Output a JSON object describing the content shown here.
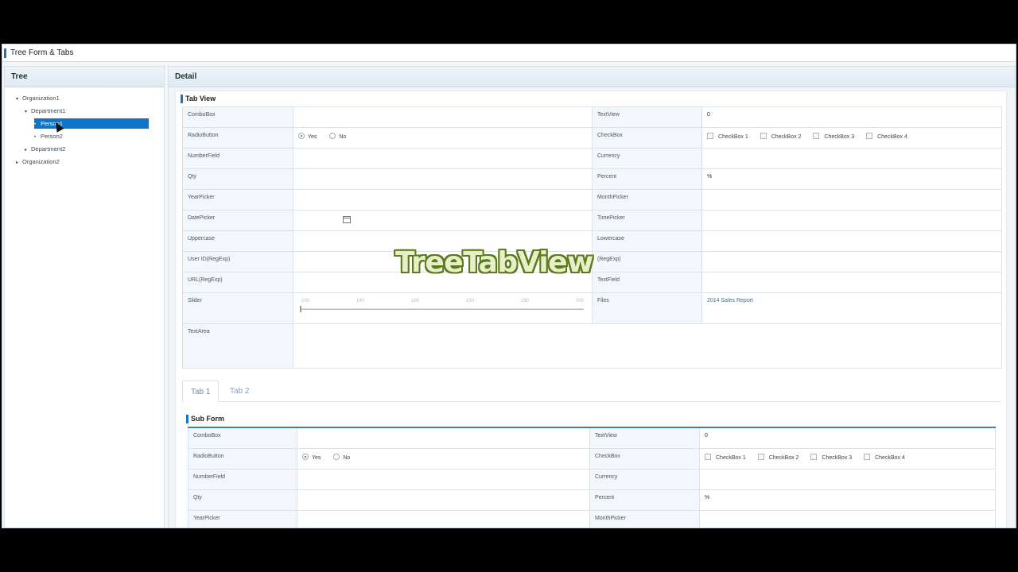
{
  "app": {
    "title": "Tree Form & Tabs"
  },
  "tree": {
    "title": "Tree",
    "nodes": [
      {
        "label": "Organization1",
        "toggle": "▾"
      },
      {
        "label": "Department1",
        "toggle": "▾"
      },
      {
        "label": "Person1",
        "toggle": "•"
      },
      {
        "label": "Person2",
        "toggle": "•"
      },
      {
        "label": "Department2",
        "toggle": "▸"
      },
      {
        "label": "Organization2",
        "toggle": "▸"
      }
    ]
  },
  "detail": {
    "title": "Detail",
    "tab_view_title": "Tab View",
    "fields": {
      "combobox": "ComboBox",
      "textview": "TextView",
      "textview_value": "0",
      "radiobutton": "RadioButton",
      "radio_yes": "Yes",
      "radio_no": "No",
      "checkbox": "CheckBox",
      "cb1": "CheckBox 1",
      "cb2": "CheckBox 2",
      "cb3": "CheckBox 3",
      "cb4": "CheckBox 4",
      "numberfield": "NumberField",
      "currency": "Currency",
      "qty": "Qty",
      "percent": "Percent",
      "percent_suffix": "%",
      "yearpicker": "YearPicker",
      "monthpicker": "MonthPicker",
      "datepicker": "DatePicker",
      "timepicker": "TimePicker",
      "uppercase": "Uppercase",
      "lowercase": "Lowercase",
      "userid": "User ID(RegExp)",
      "right_regexp": "(RegExp)",
      "url": "URL(RegExp)",
      "textfield": "TextField",
      "slider": "Slider",
      "files": "Files",
      "file_name": "2014 Sales Report",
      "textarea": "TextArea"
    },
    "slider_ticks": [
      "100",
      "140",
      "180",
      "220",
      "260",
      "300"
    ],
    "slider_value": 100,
    "tabs": [
      {
        "label": "Tab 1",
        "active": true
      },
      {
        "label": "Tab 2",
        "active": false
      }
    ],
    "sub_form_title": "Sub Form"
  },
  "overlay": {
    "watermark": "TreeTabView"
  },
  "colors": {
    "accent": "#1e73be",
    "selected": "#1175c7",
    "watermark_fill": "#e6efc8",
    "watermark_stroke": "#5a7a1c"
  }
}
